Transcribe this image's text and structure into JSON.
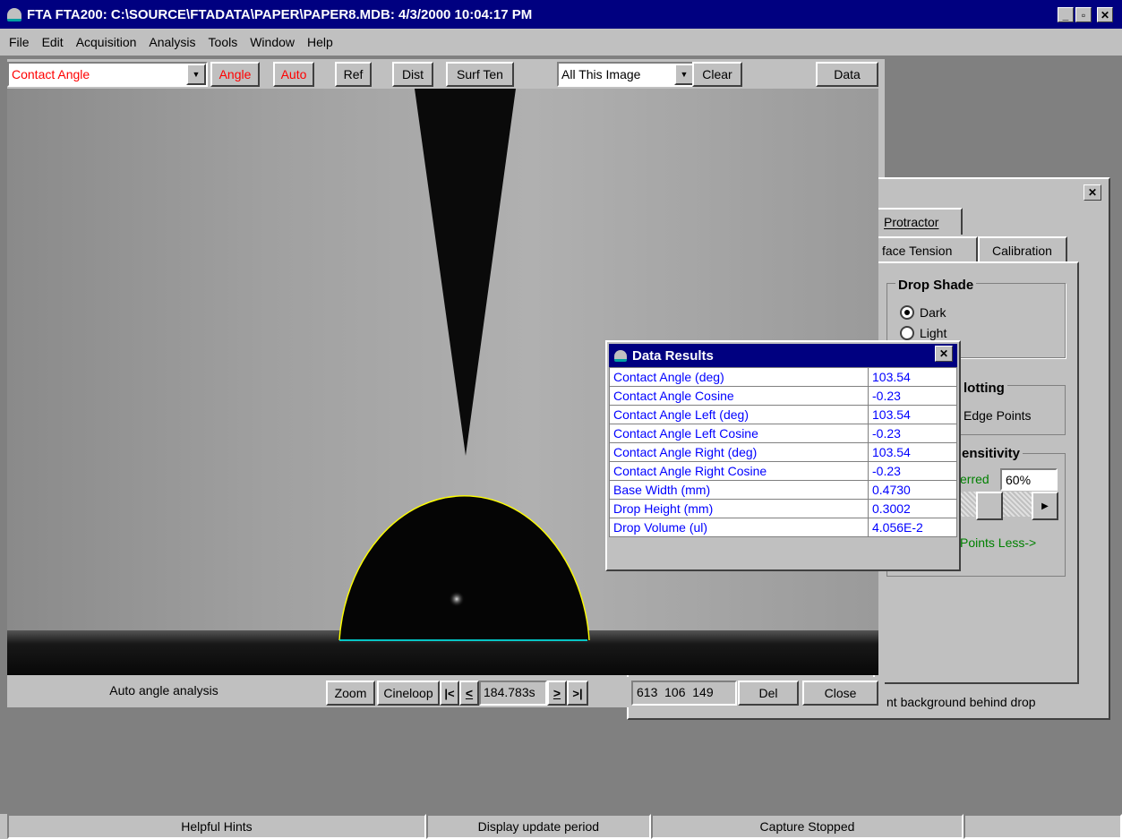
{
  "app": {
    "title": "FTA FTA200: C:\\SOURCE\\FTADATA\\PAPER\\PAPER8.MDB: 4/3/2000 10:04:17 PM",
    "window_controls": [
      "_",
      "▫",
      "✕"
    ]
  },
  "menu": [
    "File",
    "Edit",
    "Acquisition",
    "Analysis",
    "Tools",
    "Window",
    "Help"
  ],
  "toolbar": {
    "mode_select": "Contact Angle",
    "angle": "Angle",
    "auto": "Auto",
    "ref": "Ref",
    "dist": "Dist",
    "surf_ten": "Surf Ten",
    "scope_select": "All This Image",
    "clear": "Clear",
    "data": "Data"
  },
  "side_panel": {
    "tab_protractor": "Protractor",
    "tab_surface_tension": "face Tension",
    "tab_calibration": "Calibration",
    "drop_shade": "Drop Shade",
    "dark": "Dark",
    "light": "Light",
    "plotting": "lotting",
    "edge_points": "Edge Points",
    "sensitivity": "ensitivity",
    "preferred": "erred",
    "sensitivity_value": "60%",
    "points_less": "Points  Less->",
    "hint": "nt background behind drop"
  },
  "data_results": {
    "title": "Data Results",
    "rows": [
      {
        "label": "Contact Angle (deg)",
        "value": "103.54"
      },
      {
        "label": "Contact Angle Cosine",
        "value": "-0.23"
      },
      {
        "label": "Contact Angle Left (deg)",
        "value": "103.54"
      },
      {
        "label": "Contact Angle Left Cosine",
        "value": "-0.23"
      },
      {
        "label": "Contact Angle Right (deg)",
        "value": "103.54"
      },
      {
        "label": "Contact Angle Right Cosine",
        "value": "-0.23"
      },
      {
        "label": "Base Width (mm)",
        "value": "0.4730"
      },
      {
        "label": "Drop Height (mm)",
        "value": "0.3002"
      },
      {
        "label": "Drop Volume (ul)",
        "value": "4.056E-2"
      }
    ]
  },
  "image_bar": {
    "status": "Auto angle analysis",
    "zoom": "Zoom",
    "cineloop": "Cineloop",
    "first": "|<",
    "prev": "<",
    "time": "184.783s",
    "next": ">",
    "last": ">|",
    "pixel": "613  106  149",
    "del": "Del",
    "close": "Close"
  },
  "statusbar": [
    "Helpful Hints",
    "Display update period",
    "Capture Stopped",
    ""
  ],
  "colors": {
    "title_blue": "#000080",
    "link_blue": "#0000ff",
    "accent_red": "#ff0000",
    "fit_yellow": "#ffff00",
    "baseline_cyan": "#00ffff"
  }
}
